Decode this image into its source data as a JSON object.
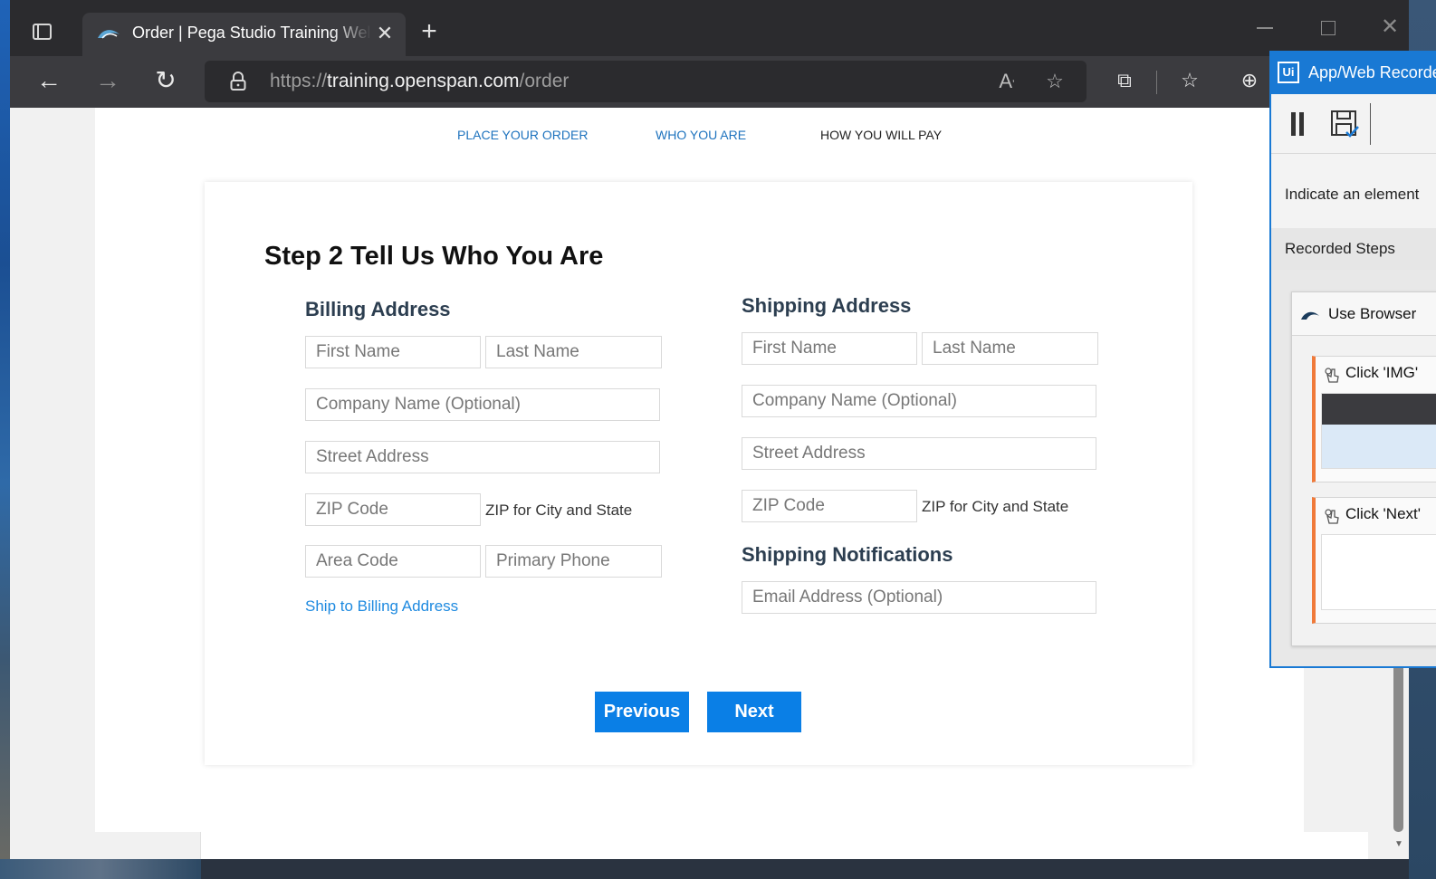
{
  "browser": {
    "tab_title": "Order | Pega Studio Training Website",
    "tab_close": "✕",
    "new_tab": "+",
    "url_scheme": "https://",
    "url_host": "training.openspan.com",
    "url_path": "/order"
  },
  "steps_nav": {
    "step1": "PLACE YOUR ORDER",
    "step2": "WHO YOU ARE",
    "step3": "HOW YOU WILL PAY"
  },
  "form": {
    "title": "Step 2 Tell Us Who You Are",
    "billing": {
      "heading": "Billing Address",
      "first_name": "First Name",
      "last_name": "Last Name",
      "company": "Company Name (Optional)",
      "street": "Street Address",
      "zip": "ZIP Code",
      "zip_hint": "ZIP for City and State",
      "area_code": "Area Code",
      "phone": "Primary Phone",
      "ship_link": "Ship to Billing Address"
    },
    "shipping": {
      "heading": "Shipping Address",
      "first_name": "First Name",
      "last_name": "Last Name",
      "company": "Company Name (Optional)",
      "street": "Street Address",
      "zip": "ZIP Code",
      "zip_hint": "ZIP for City and State"
    },
    "notifications": {
      "heading": "Shipping Notifications",
      "email": "Email Address (Optional)"
    },
    "buttons": {
      "previous": "Previous",
      "next": "Next"
    }
  },
  "recorder": {
    "logo": "Ui",
    "title": "App/Web Recorder",
    "hint": "Indicate an element",
    "steps_heading": "Recorded Steps",
    "container_label": "Use Browser",
    "steps": [
      {
        "label": "Click 'IMG'"
      },
      {
        "label": "Click 'Next'"
      }
    ]
  },
  "colors": {
    "accent": "#0a7fe6",
    "link": "#1e73be",
    "recorder_blue": "#1979d4",
    "step_accent": "#f07a3a"
  }
}
